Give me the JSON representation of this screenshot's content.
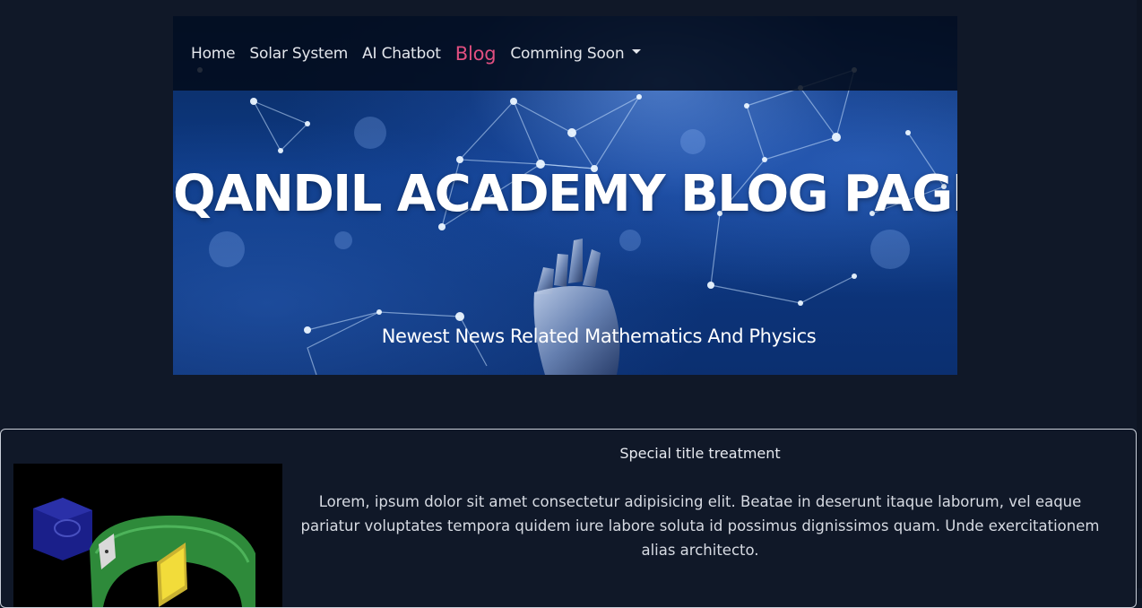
{
  "navbar": {
    "links": [
      {
        "label": "Home"
      },
      {
        "label": "Solar System"
      },
      {
        "label": "AI Chatbot"
      },
      {
        "label": "Blog",
        "active": true
      },
      {
        "label": "Comming Soon",
        "dropdown": true
      }
    ],
    "active_color": "#e14f80"
  },
  "hero": {
    "title": "QANDIL ACADEMY BLOG PAGE",
    "subtitle": "Newest News Related Mathematics And Physics"
  },
  "card": {
    "title": "Special title treatment",
    "text": "Lorem, ipsum dolor sit amet consectetur adipisicing elit. Beatae in deserunt itaque laborum, vel eaque pariatur voluptates tempora quidem iure labore soluta id possimus dignissimos quam. Unde exercitationem alias architecto."
  },
  "colors": {
    "page_background": "#101828",
    "navbar_background": "#020a1a"
  }
}
